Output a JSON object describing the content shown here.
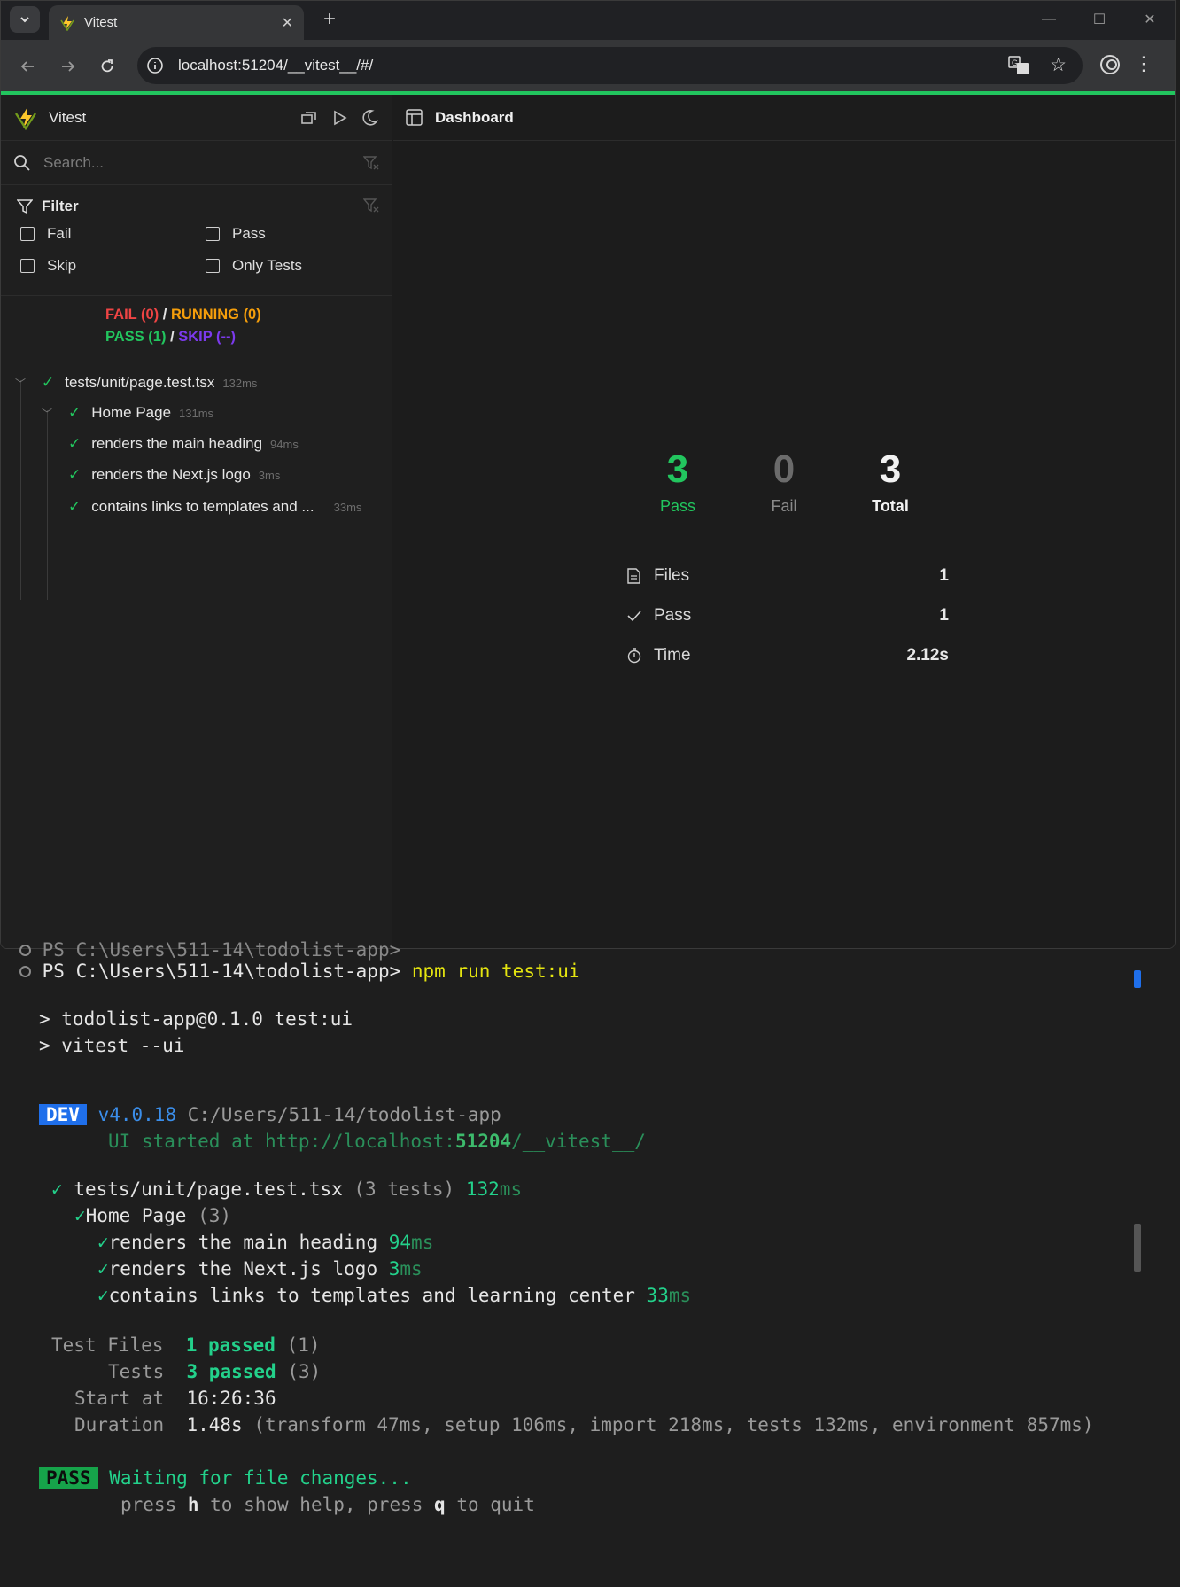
{
  "browser": {
    "tab_title": "Vitest",
    "url": "localhost:51204/__vitest__/#/",
    "accent": "#22c55e"
  },
  "sidebar": {
    "title": "Vitest",
    "search_placeholder": "Search...",
    "filter_title": "Filter",
    "filters": [
      "Fail",
      "Pass",
      "Skip",
      "Only Tests"
    ],
    "summary": {
      "fail": "FAIL (0)",
      "running": "RUNNING (0)",
      "pass": "PASS (1)",
      "skip": "SKIP (--)",
      "sep": "/"
    },
    "tree": [
      {
        "label": "tests/unit/page.test.tsx",
        "duration": "132ms"
      },
      {
        "label": "Home Page",
        "duration": "131ms"
      },
      {
        "label": "renders the main heading",
        "duration": "94ms"
      },
      {
        "label": "renders the Next.js logo",
        "duration": "3ms"
      },
      {
        "label": "contains links to templates and ...",
        "duration": "33ms"
      }
    ]
  },
  "dashboard": {
    "title": "Dashboard",
    "stats": [
      {
        "value": "3",
        "label": "Pass",
        "color": "#22c55e"
      },
      {
        "value": "0",
        "label": "Fail",
        "color": "#6b6b6b"
      },
      {
        "value": "3",
        "label": "Total",
        "color": "#f2f2f2"
      }
    ],
    "details": [
      {
        "key": "Files",
        "value": "1",
        "icon": "file-icon"
      },
      {
        "key": "Pass",
        "value": "1",
        "icon": "check-icon"
      },
      {
        "key": "Time",
        "value": "2.12s",
        "icon": "timer-icon"
      }
    ]
  },
  "terminal": {
    "partial_line": "PS C:\\Users\\511-14\\todolist-app>",
    "prompt": "PS C:\\Users\\511-14\\todolist-app>",
    "command": "npm run test:ui",
    "out1": "> todolist-app@0.1.0 test:ui",
    "out2": "> vitest --ui",
    "dev_badge": "DEV",
    "version": "v4.0.18",
    "path": "C:/Users/511-14/todolist-app",
    "ui_prefix": "UI started at http://localhost:",
    "ui_port": "51204",
    "ui_suffix": "/__vitest__/",
    "check": "✓",
    "file": "tests/unit/page.test.tsx",
    "file_count": "(3 tests)",
    "file_ms": "132",
    "suite": "Home Page",
    "suite_count": "(3)",
    "tests": [
      {
        "name": "renders the main heading",
        "ms": "94"
      },
      {
        "name": "renders the Next.js logo",
        "ms": "3"
      },
      {
        "name": "contains links to templates and learning center",
        "ms": "33"
      }
    ],
    "ms_unit": "ms",
    "test_files_label": "Test Files",
    "test_files_value": "1 passed",
    "test_files_count": "(1)",
    "tests_label": "Tests",
    "tests_value": "3 passed",
    "tests_count": "(3)",
    "start_label": "Start at",
    "start_value": "16:26:36",
    "duration_label": "Duration",
    "duration_value": "1.48s",
    "duration_detail": "(transform 47ms, setup 106ms, import 218ms, tests 132ms, environment 857ms)",
    "pass_badge": "PASS",
    "waiting": "Waiting for file changes...",
    "help_1": "press ",
    "help_h": "h",
    "help_2": " to show help, press ",
    "help_q": "q",
    "help_3": " to quit"
  }
}
